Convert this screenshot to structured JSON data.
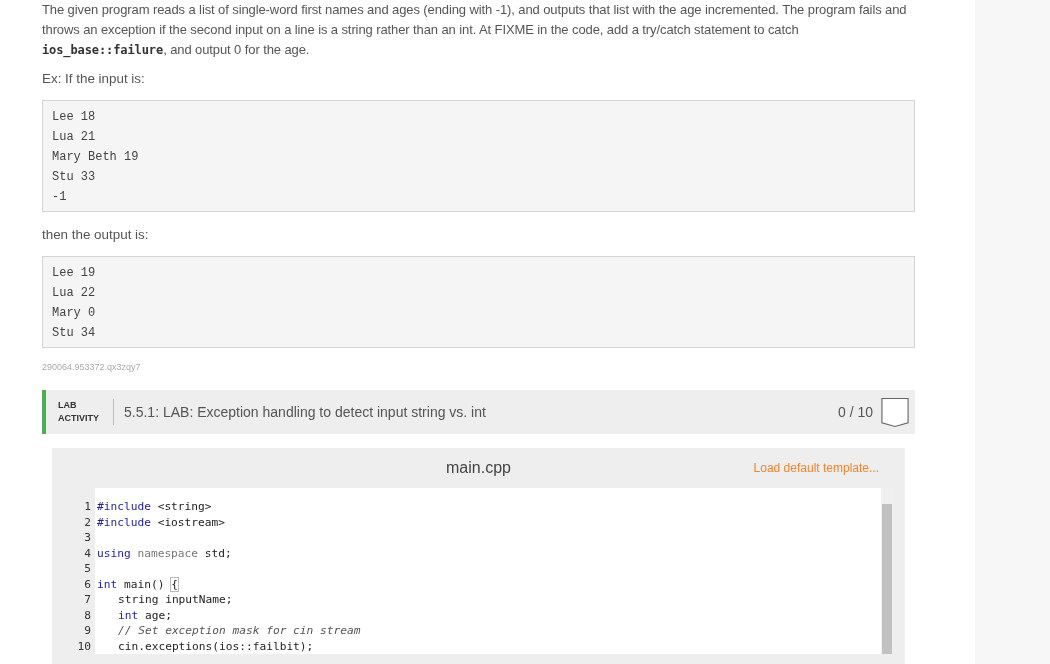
{
  "intro": [
    {
      "kind": "text",
      "text": "The given program reads a list of single-word first names and ages (ending with -1), and outputs that list with the age incremented. The program fails and throws an exception if the second input on a line is a string rather than an int. At FIXME in the code, add a try/catch statement to catch "
    },
    {
      "kind": "code",
      "text": "ios_base::failure"
    },
    {
      "kind": "text",
      "text": ", and output 0 for the age."
    }
  ],
  "input_label": "Ex: If the input is:",
  "input_lines": [
    "Lee 18",
    "Lua 21",
    "Mary Beth 19",
    "Stu 33",
    "-1"
  ],
  "output_label": "then the output is:",
  "output_lines": [
    "Lee 19",
    "Lua 22",
    "Mary 0",
    "Stu 34"
  ],
  "footnote": "290064.953372.qx3zqy7",
  "lab": {
    "tag_lines": [
      "LAB",
      "ACTIVITY"
    ],
    "title": "5.5.1: LAB: Exception handling to detect input string vs. int",
    "score": "0 / 10"
  },
  "editor": {
    "filename": "main.cpp",
    "template_link": "Load default template...",
    "lines": [
      {
        "number": "1",
        "parts": [
          {
            "kind": "keyword",
            "text": "#include"
          },
          {
            "kind": "plain",
            "text": "<string>"
          }
        ]
      },
      {
        "number": "2",
        "parts": [
          {
            "kind": "keyword",
            "text": "#include"
          },
          {
            "kind": "plain",
            "text": "<iostream>"
          }
        ]
      },
      {
        "number": "3"
      },
      {
        "number": "4",
        "parts": [
          {
            "kind": "keyword",
            "text": "using"
          },
          {
            "kind": "muted",
            "text": "namespace"
          },
          {
            "kind": "plain",
            "text": "std;"
          }
        ]
      },
      {
        "number": "5"
      },
      {
        "number": "6",
        "parts": [
          {
            "kind": "keyword",
            "text": "int"
          },
          {
            "kind": "plain",
            "text": "main()"
          },
          {
            "kind": "bracket",
            "text": "{"
          }
        ]
      },
      {
        "number": "7",
        "indented": true,
        "parts": [
          {
            "kind": "plain",
            "text": "string inputName;"
          }
        ]
      },
      {
        "number": "8",
        "indented": true,
        "parts": [
          {
            "kind": "keyword",
            "text": "int"
          },
          {
            "kind": "plain",
            "text": "age;"
          }
        ]
      },
      {
        "number": "9",
        "indented": true,
        "parts": [
          {
            "kind": "comment",
            "text": "// Set exception mask for cin stream"
          }
        ]
      },
      {
        "number": "10",
        "indented": true,
        "parts": [
          {
            "kind": "plain",
            "text": "cin.exceptions(ios::failbit);"
          }
        ]
      }
    ]
  }
}
